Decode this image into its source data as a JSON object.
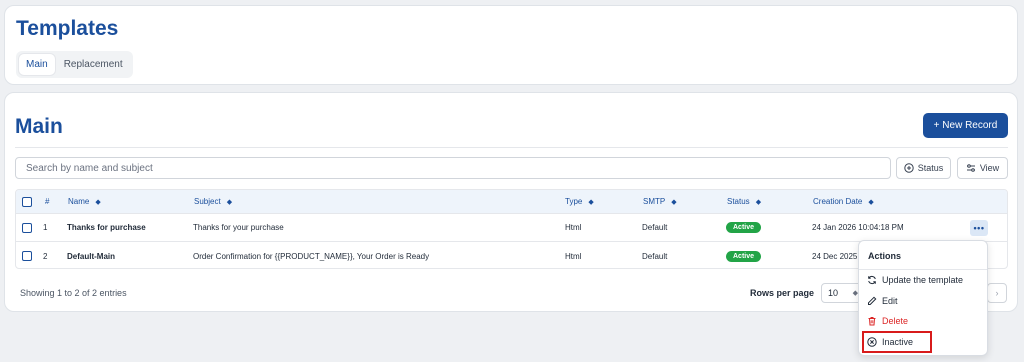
{
  "header": {
    "title": "Templates",
    "tabs": [
      {
        "label": "Main",
        "active": true
      },
      {
        "label": "Replacement",
        "active": false
      }
    ]
  },
  "main": {
    "title": "Main",
    "new_button_label": "+ New Record",
    "search_placeholder": "Search by name and subject",
    "status_button_label": "Status",
    "view_button_label": "View"
  },
  "table": {
    "columns": [
      "#",
      "Name",
      "Subject",
      "Type",
      "SMTP",
      "Status",
      "Creation Date"
    ],
    "rows": [
      {
        "num": "1",
        "name": "Thanks for purchase",
        "subject": "Thanks for your purchase",
        "type": "Html",
        "smtp": "Default",
        "status": "Active",
        "date": "24 Jan 2026 10:04:18 PM"
      },
      {
        "num": "2",
        "name": "Default-Main",
        "subject": "Order Confirmation for {{PRODUCT_NAME}}, Your Order is Ready",
        "type": "Html",
        "smtp": "Default",
        "status": "Active",
        "date": "24 Dec 2025"
      }
    ]
  },
  "footer": {
    "entries_text": "Showing 1 to 2 of 2 entries",
    "rows_per_page_label": "Rows per page",
    "rows_per_page_value": "10"
  },
  "actions_menu": {
    "title": "Actions",
    "items": [
      "Update the template",
      "Edit",
      "Delete",
      "Inactive"
    ],
    "highlighted_item": "Inactive"
  },
  "colors": {
    "brand": "#1b4f9c",
    "active_badge": "#22a447",
    "danger": "#dc2626",
    "highlight_box": "#d81b1b"
  }
}
